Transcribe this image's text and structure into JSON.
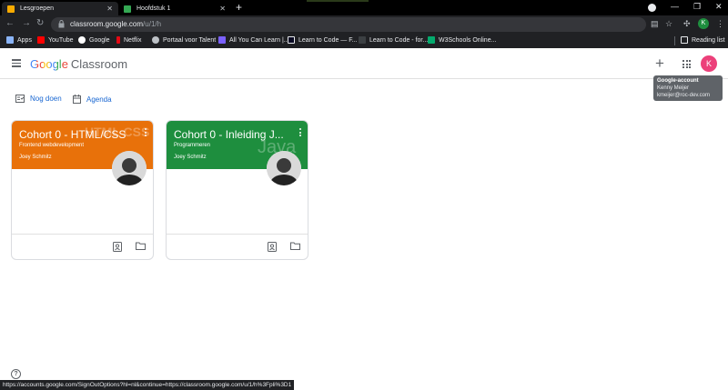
{
  "browser": {
    "tabs": [
      {
        "title": "Lesgroepen",
        "active": true,
        "favicon_color": "#f9ab00"
      },
      {
        "title": "Hoofdstuk 1",
        "active": false,
        "favicon_color": "#34a853"
      }
    ],
    "url_host": "classroom.google.com",
    "url_path": "/u/1/h",
    "bookmarks": [
      {
        "label": "Apps",
        "icon": "apps-grid-icon"
      },
      {
        "label": "YouTube",
        "icon": "youtube-icon"
      },
      {
        "label": "Google",
        "icon": "google-icon"
      },
      {
        "label": "Netflix",
        "icon": "netflix-icon"
      },
      {
        "label": "Portaal voor Talent",
        "icon": "globe-icon"
      },
      {
        "label": "All You Can Learn |...",
        "icon": "ayl-icon"
      },
      {
        "label": "Learn to Code — F...",
        "icon": "freecodecamp-icon"
      },
      {
        "label": "Learn to Code - for...",
        "icon": "page-icon"
      },
      {
        "label": "W3Schools Online...",
        "icon": "w3schools-icon"
      }
    ],
    "reading_list": "Reading list",
    "profile_initial": "K"
  },
  "classroom": {
    "brand_google": "Google",
    "brand_product": "Classroom",
    "account_initial": "K",
    "tooltip": {
      "title": "Google-account",
      "name": "Kenny Meijer",
      "email": "kmeijer@roc-dev.com"
    },
    "subnav": {
      "todo": "Nog doen",
      "agenda": "Agenda"
    },
    "cards": [
      {
        "title": "Cohort 0 - HTML/CSS",
        "section": "Frontend webdevelopment",
        "teacher": "Joey Schmitz",
        "color": "#e8710a",
        "deco": "HTML CSS"
      },
      {
        "title": "Cohort 0 - Inleiding J...",
        "section": "Programmeren",
        "teacher": "Joey Schmitz",
        "color": "#1e8e3e",
        "deco": "Java"
      }
    ]
  },
  "status_url": "https://accounts.google.com/SignOutOptions?hl=nl&continue=https://classroom.google.com/u/1/h%3Fpli%3D1"
}
